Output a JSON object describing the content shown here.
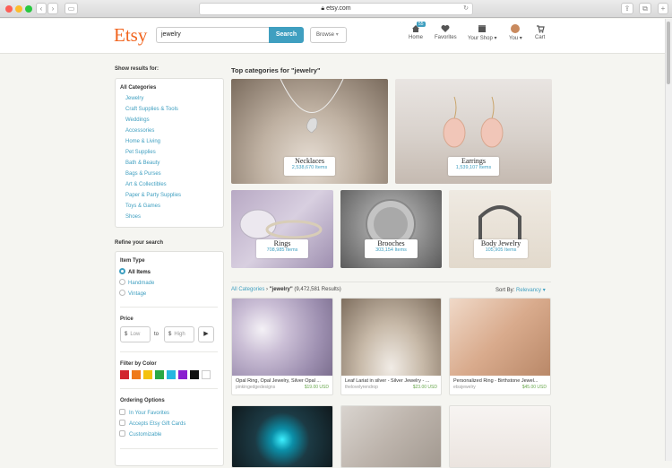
{
  "browser": {
    "url": "etsy.com"
  },
  "header": {
    "logo": "Etsy",
    "search_value": "jewelry",
    "search_button": "Search",
    "browse": "Browse",
    "nav": [
      {
        "label": "Home",
        "badge": "55"
      },
      {
        "label": "Favorites"
      },
      {
        "label": "Your Shop"
      },
      {
        "label": "You"
      },
      {
        "label": "Cart"
      }
    ]
  },
  "sidebar": {
    "show_results": "Show results for:",
    "all_categories": "All Categories",
    "categories": [
      "Jewelry",
      "Craft Supplies & Tools",
      "Weddings",
      "Accessories",
      "Home & Living",
      "Pet Supplies",
      "Bath & Beauty",
      "Bags & Purses",
      "Art & Collectibles",
      "Paper & Party Supplies",
      "Toys & Games",
      "Shoes"
    ],
    "refine": "Refine your search",
    "item_type": "Item Type",
    "item_types": [
      "All Items",
      "Handmade",
      "Vintage"
    ],
    "price": "Price",
    "low": "Low",
    "high": "High",
    "to": "to",
    "currency": "$",
    "filter_color": "Filter by Color",
    "colors": [
      "#d2242e",
      "#ef7a1a",
      "#f4c20d",
      "#2aa845",
      "#26b7e0",
      "#8a1fd0",
      "#111111",
      "#ffffff"
    ],
    "ordering": "Ordering Options",
    "ordering_opts": [
      "In Your Favorites",
      "Accepts Etsy Gift Cards",
      "Customizable"
    ]
  },
  "main": {
    "top_title": "Top categories for \"jewelry\"",
    "top_categories": [
      {
        "name": "Necklaces",
        "count": "2,538,670 Items"
      },
      {
        "name": "Earrings",
        "count": "1,539,107 Items"
      },
      {
        "name": "Rings",
        "count": "708,985 Items"
      },
      {
        "name": "Brooches",
        "count": "303,154 Items"
      },
      {
        "name": "Body Jewelry",
        "count": "105,905 Items"
      }
    ],
    "crumb_all": "All Categories",
    "crumb_sep": "›",
    "crumb_query": "\"jewelry\"",
    "crumb_count": "(9,472,581 Results)",
    "sort_label": "Sort By:",
    "sort_value": "Relevancy",
    "listings": [
      {
        "title": "Opal Ring, Opal Jewelry, Silver Opal ...",
        "shop": "pinkingedgedesigns",
        "price": "$19.00 USD"
      },
      {
        "title": "Leaf Lariat in silver - Silver Jewelry - ...",
        "shop": "thelovelyrendrop",
        "price": "$23.00 USD"
      },
      {
        "title": "Personalized Ring - Birthstone Jewel...",
        "shop": "etssjewelry",
        "price": "$45.00 USD"
      }
    ]
  }
}
